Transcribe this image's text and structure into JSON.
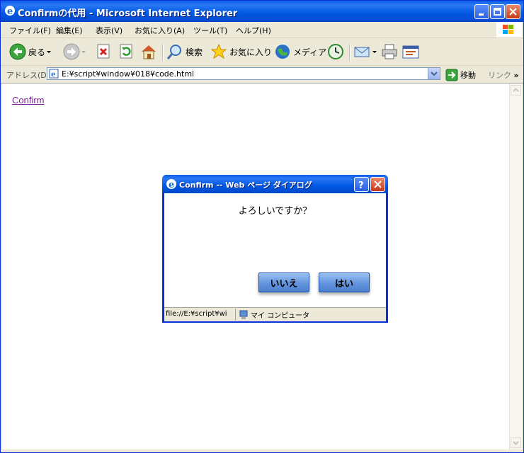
{
  "window": {
    "title": "Confirmの代用 - Microsoft Internet Explorer"
  },
  "menu": [
    "ファイル(F)",
    "編集(E)",
    "表示(V)",
    "お気に入り(A)",
    "ツール(T)",
    "ヘルプ(H)"
  ],
  "toolbar": {
    "back": "戻る",
    "search": "検索",
    "favorites": "お気に入り",
    "media": "メディア"
  },
  "address": {
    "label": "アドレス(D)",
    "url": "E:¥script¥window¥018¥code.html",
    "go": "移動",
    "links": "リンク"
  },
  "page": {
    "link": "Confirm"
  },
  "dialog": {
    "title": "Confirm -- Web ページ ダイアログ",
    "message": "よろしいですか？",
    "no": "いいえ",
    "yes": "はい",
    "status_path": "file://E:¥script¥wi",
    "status_zone": "マイ コンピュータ"
  },
  "colors": {
    "titlebar": "#0058e3",
    "chrome": "#ece9d8",
    "visited_link": "#7b1f9a"
  }
}
